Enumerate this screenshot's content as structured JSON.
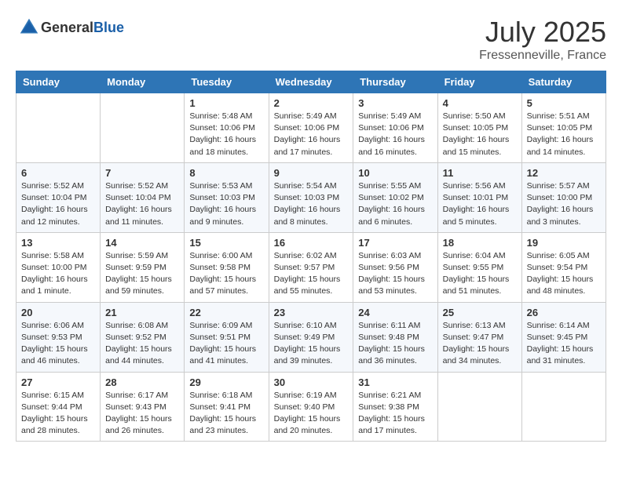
{
  "header": {
    "logo_general": "General",
    "logo_blue": "Blue",
    "month": "July 2025",
    "location": "Fressenneville, France"
  },
  "days_of_week": [
    "Sunday",
    "Monday",
    "Tuesday",
    "Wednesday",
    "Thursday",
    "Friday",
    "Saturday"
  ],
  "weeks": [
    [
      {
        "day": "",
        "info": ""
      },
      {
        "day": "",
        "info": ""
      },
      {
        "day": "1",
        "sunrise": "Sunrise: 5:48 AM",
        "sunset": "Sunset: 10:06 PM",
        "daylight": "Daylight: 16 hours and 18 minutes."
      },
      {
        "day": "2",
        "sunrise": "Sunrise: 5:49 AM",
        "sunset": "Sunset: 10:06 PM",
        "daylight": "Daylight: 16 hours and 17 minutes."
      },
      {
        "day": "3",
        "sunrise": "Sunrise: 5:49 AM",
        "sunset": "Sunset: 10:06 PM",
        "daylight": "Daylight: 16 hours and 16 minutes."
      },
      {
        "day": "4",
        "sunrise": "Sunrise: 5:50 AM",
        "sunset": "Sunset: 10:05 PM",
        "daylight": "Daylight: 16 hours and 15 minutes."
      },
      {
        "day": "5",
        "sunrise": "Sunrise: 5:51 AM",
        "sunset": "Sunset: 10:05 PM",
        "daylight": "Daylight: 16 hours and 14 minutes."
      }
    ],
    [
      {
        "day": "6",
        "sunrise": "Sunrise: 5:52 AM",
        "sunset": "Sunset: 10:04 PM",
        "daylight": "Daylight: 16 hours and 12 minutes."
      },
      {
        "day": "7",
        "sunrise": "Sunrise: 5:52 AM",
        "sunset": "Sunset: 10:04 PM",
        "daylight": "Daylight: 16 hours and 11 minutes."
      },
      {
        "day": "8",
        "sunrise": "Sunrise: 5:53 AM",
        "sunset": "Sunset: 10:03 PM",
        "daylight": "Daylight: 16 hours and 9 minutes."
      },
      {
        "day": "9",
        "sunrise": "Sunrise: 5:54 AM",
        "sunset": "Sunset: 10:03 PM",
        "daylight": "Daylight: 16 hours and 8 minutes."
      },
      {
        "day": "10",
        "sunrise": "Sunrise: 5:55 AM",
        "sunset": "Sunset: 10:02 PM",
        "daylight": "Daylight: 16 hours and 6 minutes."
      },
      {
        "day": "11",
        "sunrise": "Sunrise: 5:56 AM",
        "sunset": "Sunset: 10:01 PM",
        "daylight": "Daylight: 16 hours and 5 minutes."
      },
      {
        "day": "12",
        "sunrise": "Sunrise: 5:57 AM",
        "sunset": "Sunset: 10:00 PM",
        "daylight": "Daylight: 16 hours and 3 minutes."
      }
    ],
    [
      {
        "day": "13",
        "sunrise": "Sunrise: 5:58 AM",
        "sunset": "Sunset: 10:00 PM",
        "daylight": "Daylight: 16 hours and 1 minute."
      },
      {
        "day": "14",
        "sunrise": "Sunrise: 5:59 AM",
        "sunset": "Sunset: 9:59 PM",
        "daylight": "Daylight: 15 hours and 59 minutes."
      },
      {
        "day": "15",
        "sunrise": "Sunrise: 6:00 AM",
        "sunset": "Sunset: 9:58 PM",
        "daylight": "Daylight: 15 hours and 57 minutes."
      },
      {
        "day": "16",
        "sunrise": "Sunrise: 6:02 AM",
        "sunset": "Sunset: 9:57 PM",
        "daylight": "Daylight: 15 hours and 55 minutes."
      },
      {
        "day": "17",
        "sunrise": "Sunrise: 6:03 AM",
        "sunset": "Sunset: 9:56 PM",
        "daylight": "Daylight: 15 hours and 53 minutes."
      },
      {
        "day": "18",
        "sunrise": "Sunrise: 6:04 AM",
        "sunset": "Sunset: 9:55 PM",
        "daylight": "Daylight: 15 hours and 51 minutes."
      },
      {
        "day": "19",
        "sunrise": "Sunrise: 6:05 AM",
        "sunset": "Sunset: 9:54 PM",
        "daylight": "Daylight: 15 hours and 48 minutes."
      }
    ],
    [
      {
        "day": "20",
        "sunrise": "Sunrise: 6:06 AM",
        "sunset": "Sunset: 9:53 PM",
        "daylight": "Daylight: 15 hours and 46 minutes."
      },
      {
        "day": "21",
        "sunrise": "Sunrise: 6:08 AM",
        "sunset": "Sunset: 9:52 PM",
        "daylight": "Daylight: 15 hours and 44 minutes."
      },
      {
        "day": "22",
        "sunrise": "Sunrise: 6:09 AM",
        "sunset": "Sunset: 9:51 PM",
        "daylight": "Daylight: 15 hours and 41 minutes."
      },
      {
        "day": "23",
        "sunrise": "Sunrise: 6:10 AM",
        "sunset": "Sunset: 9:49 PM",
        "daylight": "Daylight: 15 hours and 39 minutes."
      },
      {
        "day": "24",
        "sunrise": "Sunrise: 6:11 AM",
        "sunset": "Sunset: 9:48 PM",
        "daylight": "Daylight: 15 hours and 36 minutes."
      },
      {
        "day": "25",
        "sunrise": "Sunrise: 6:13 AM",
        "sunset": "Sunset: 9:47 PM",
        "daylight": "Daylight: 15 hours and 34 minutes."
      },
      {
        "day": "26",
        "sunrise": "Sunrise: 6:14 AM",
        "sunset": "Sunset: 9:45 PM",
        "daylight": "Daylight: 15 hours and 31 minutes."
      }
    ],
    [
      {
        "day": "27",
        "sunrise": "Sunrise: 6:15 AM",
        "sunset": "Sunset: 9:44 PM",
        "daylight": "Daylight: 15 hours and 28 minutes."
      },
      {
        "day": "28",
        "sunrise": "Sunrise: 6:17 AM",
        "sunset": "Sunset: 9:43 PM",
        "daylight": "Daylight: 15 hours and 26 minutes."
      },
      {
        "day": "29",
        "sunrise": "Sunrise: 6:18 AM",
        "sunset": "Sunset: 9:41 PM",
        "daylight": "Daylight: 15 hours and 23 minutes."
      },
      {
        "day": "30",
        "sunrise": "Sunrise: 6:19 AM",
        "sunset": "Sunset: 9:40 PM",
        "daylight": "Daylight: 15 hours and 20 minutes."
      },
      {
        "day": "31",
        "sunrise": "Sunrise: 6:21 AM",
        "sunset": "Sunset: 9:38 PM",
        "daylight": "Daylight: 15 hours and 17 minutes."
      },
      {
        "day": "",
        "info": ""
      },
      {
        "day": "",
        "info": ""
      }
    ]
  ]
}
